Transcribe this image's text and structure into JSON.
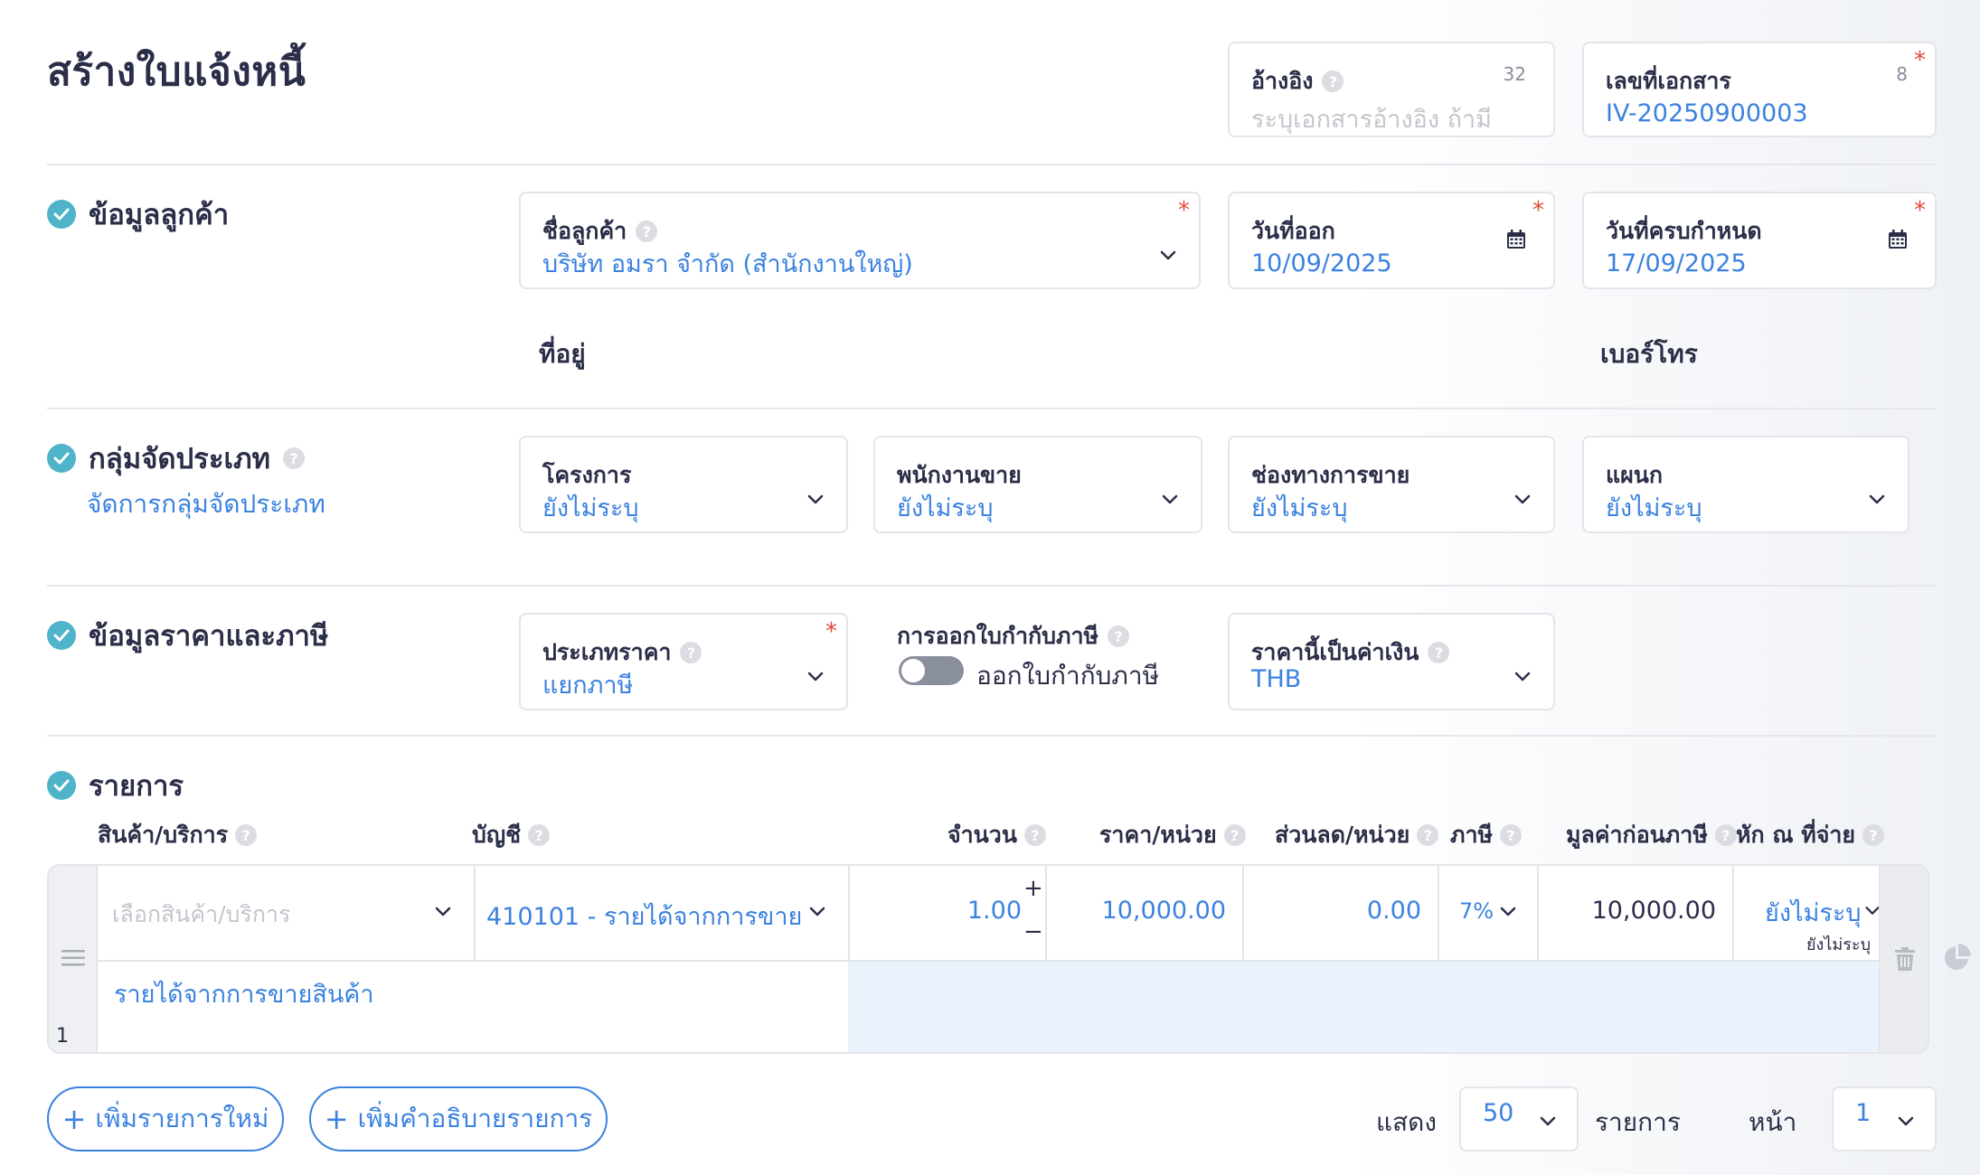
{
  "page": {
    "title": "สร้างใบแจ้งหนี้"
  },
  "header_fields": {
    "reference": {
      "label": "อ้างอิง",
      "counter": "32",
      "placeholder": "ระบุเอกสารอ้างอิง ถ้ามี"
    },
    "doc_number": {
      "label": "เลขที่เอกสาร",
      "counter": "8",
      "value": "IV-20250900003"
    }
  },
  "customer_section": {
    "title": "ข้อมูลลูกค้า",
    "customer_name": {
      "label": "ชื่อลูกค้า",
      "value": "บริษัท อมรา จำกัด (สำนักงานใหญ่)"
    },
    "issue_date": {
      "label": "วันที่ออก",
      "value": "10/09/2025"
    },
    "due_date": {
      "label": "วันที่ครบกำหนด",
      "value": "17/09/2025"
    },
    "address_label": "ที่อยู่",
    "phone_label": "เบอร์โทร"
  },
  "category_section": {
    "title": "กลุ่มจัดประเภท",
    "manage_link": "จัดการกลุ่มจัดประเภท",
    "project": {
      "label": "โครงการ",
      "value": "ยังไม่ระบุ"
    },
    "salesperson": {
      "label": "พนักงานขาย",
      "value": "ยังไม่ระบุ"
    },
    "channel": {
      "label": "ช่องทางการขาย",
      "value": "ยังไม่ระบุ"
    },
    "department": {
      "label": "แผนก",
      "value": "ยังไม่ระบุ"
    }
  },
  "price_section": {
    "title": "ข้อมูลราคาและภาษี",
    "price_type": {
      "label": "ประเภทราคา",
      "value": "แยกภาษี"
    },
    "tax_invoice": {
      "label": "การออกใบกำกับภาษี",
      "toggle_text": "ออกใบกำกับภาษี",
      "enabled": false
    },
    "currency": {
      "label": "ราคานี้เป็นค่าเงิน",
      "value": "THB"
    }
  },
  "items_section": {
    "title": "รายการ",
    "columns": {
      "product": "สินค้า/บริการ",
      "account": "บัญชี",
      "qty": "จำนวน",
      "unit_price": "ราคา/หน่วย",
      "discount": "ส่วนลด/หน่วย",
      "tax": "ภาษี",
      "pre_tax": "มูลค่าก่อนภาษี",
      "withholding": "หัก ณ ที่จ่าย"
    },
    "rows": [
      {
        "number": "1",
        "product_placeholder": "เลือกสินค้า/บริการ",
        "account": "410101 - รายได้จากการขาย...",
        "qty": "1.00",
        "unit_price": "10,000.00",
        "discount": "0.00",
        "tax": "7%",
        "pre_tax": "10,000.00",
        "withholding": "ยังไม่ระบุ",
        "withholding_sub": "ยังไม่ระบุ",
        "description": "รายได้จากการขายสินค้า"
      }
    ]
  },
  "footer": {
    "add_item": "เพิ่มรายการใหม่",
    "add_description": "เพิ่มคำอธิบายรายการ",
    "show_label": "แสดง",
    "page_size": "50",
    "items_label": "รายการ",
    "page_label": "หน้า",
    "page_number": "1"
  },
  "colors": {
    "accent": "#3b82e0",
    "check": "#4fb3c9",
    "required": "#e0493b",
    "text": "#2b2e48"
  }
}
